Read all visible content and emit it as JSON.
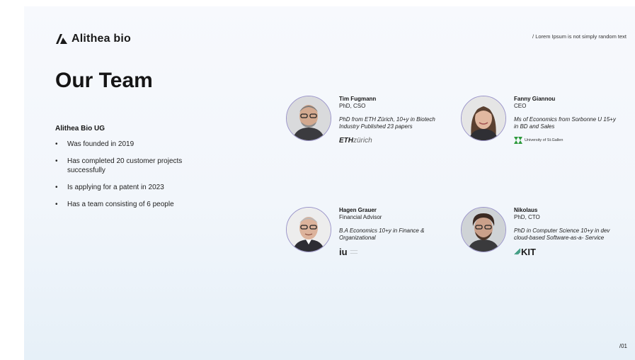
{
  "brand": {
    "name": "Alithea bio",
    "logo_icon": "alithea-mark-icon"
  },
  "tagline": "/ Lorem Ipsum is not simply random text",
  "title": "Our Team",
  "company": {
    "name": "Alithea Bio UG",
    "facts": [
      "Was founded in 2019",
      "Has completed 20 customer projects successfully",
      "Is applying for a patent in 2023",
      "Has a team consisting of 6 people"
    ]
  },
  "team": [
    {
      "name": "Tim Fugmann",
      "role": "PhD, CSO",
      "description": "PhD from ETH Zürich, 10+y in Biotech Industry Published 23 papers",
      "institution": {
        "bold": "ETH",
        "rest": "zürich"
      }
    },
    {
      "name": "Fanny Giannou",
      "role": "CEO",
      "description": "Ms of Economics from Sorbonne U 15+y in BD and Sales",
      "institution": {
        "text": "University of St.Gallen"
      }
    },
    {
      "name": "Hagen Grauer",
      "role": "Financial Advisor",
      "description": "B.A Economics 10+y in Finance & Organizational",
      "institution": {
        "text": "iu"
      }
    },
    {
      "name": "Nikolaus",
      "role": "PhD, CTO",
      "description": "PhD in Computer Science 10+y in dev cloud-based Software-as-a- Service",
      "institution": {
        "text": "KIT"
      }
    }
  ],
  "page_number": "/01",
  "colors": {
    "avatar_border": "#9b95c9",
    "background_top": "#f7f9fd",
    "background_bottom": "#e6f0f8"
  }
}
